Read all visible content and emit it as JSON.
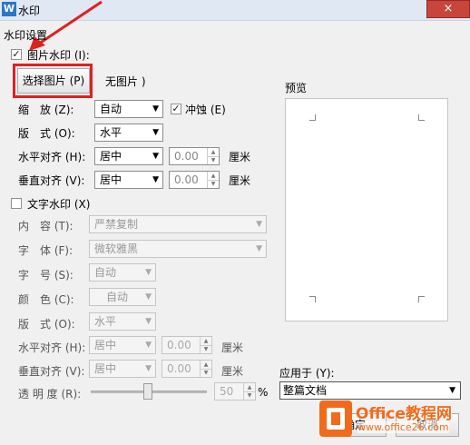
{
  "window": {
    "title": "水印",
    "icon": "wps-w-icon",
    "close": "×"
  },
  "group_title": "水印设置",
  "image_watermark": {
    "checked": true,
    "label": "图片水印 (I):",
    "select_button": "选择图片 (P)",
    "no_image": "无图片 )",
    "scale_label": "缩　放 (Z):",
    "scale_value": "自动",
    "washout_label": "冲蚀 (E)",
    "washout_checked": true,
    "layout_label": "版　式 (O):",
    "layout_value": "水平",
    "halign_label": "水平对齐 (H):",
    "halign_value": "居中",
    "halign_offset": "0.00",
    "valign_label": "垂直对齐 (V):",
    "valign_value": "居中",
    "valign_offset": "0.00",
    "unit": "厘米"
  },
  "text_watermark": {
    "checked": false,
    "label": "文字水印 (X)",
    "content_label": "内　容 (T):",
    "content_value": "严禁复制",
    "font_label": "字　体 (F):",
    "font_value": "微软雅黑",
    "size_label": "字　号 (S):",
    "size_value": "自动",
    "color_label": "颜　色 (C):",
    "color_value": "自动",
    "layout_label": "版　式 (O):",
    "layout_value": "水平",
    "halign_label": "水平对齐 (H):",
    "halign_value": "居中",
    "halign_offset": "0.00",
    "valign_label": "垂直对齐 (V):",
    "valign_value": "居中",
    "valign_offset": "0.00",
    "unit": "厘米",
    "transparency_label": "透 明 度 (R):",
    "transparency_value": "50",
    "transparency_unit": "%"
  },
  "preview": {
    "label": "预览"
  },
  "apply": {
    "label": "应用于 (Y):",
    "value": "整篇文档"
  },
  "buttons": {
    "ok": "确定",
    "cancel": "取消"
  },
  "logo": {
    "brand": "Office教程网",
    "url": "www.office26.com"
  },
  "colors": {
    "highlight": "#e02020",
    "logo_orange": "#f26a1b",
    "titlebar": "#dfe8f3"
  }
}
